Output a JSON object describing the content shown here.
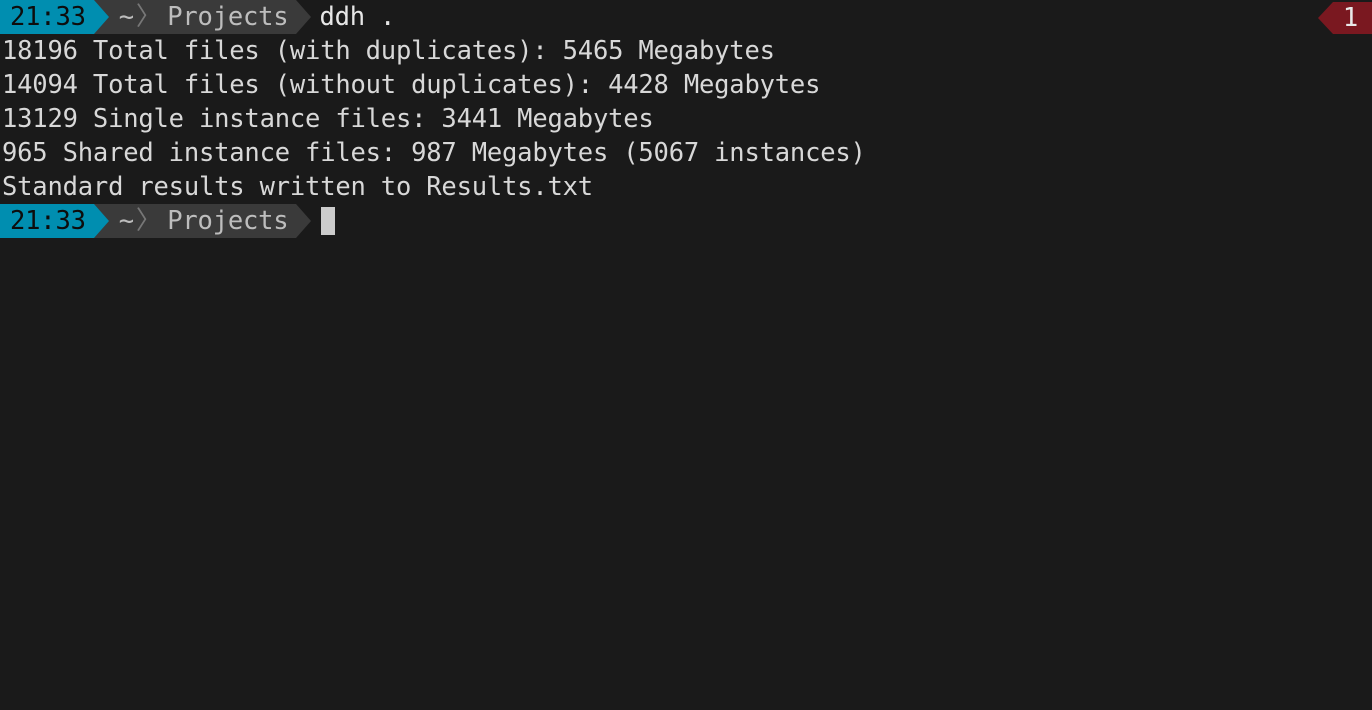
{
  "prompt1": {
    "time": "21:33",
    "path_home": "~",
    "path_dir": "Projects",
    "command": "ddh ."
  },
  "output": {
    "line1": "18196 Total files (with duplicates): 5465 Megabytes",
    "line2": "14094 Total files (without duplicates): 4428 Megabytes",
    "line3": "13129 Single instance files: 3441 Megabytes",
    "line4": "965 Shared instance files: 987 Megabytes (5067 instances)",
    "line5": "Standard results written to Results.txt"
  },
  "prompt2": {
    "time": "21:33",
    "path_home": "~",
    "path_dir": "Projects"
  },
  "status_badge": "1"
}
